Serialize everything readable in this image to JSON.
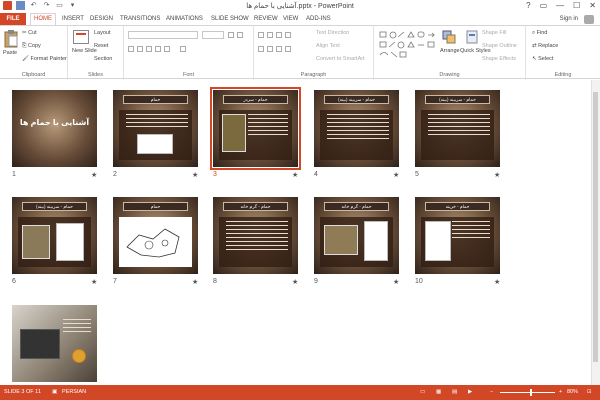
{
  "window": {
    "title": "آشنایی با حمام ها.pptx - PowerPoint",
    "controls": [
      "?",
      "▭",
      "—",
      "☐",
      "✕"
    ]
  },
  "tabs": [
    {
      "label": "FILE"
    },
    {
      "label": "HOME"
    },
    {
      "label": "INSERT"
    },
    {
      "label": "DESIGN"
    },
    {
      "label": "TRANSITIONS"
    },
    {
      "label": "ANIMATIONS"
    },
    {
      "label": "SLIDE SHOW"
    },
    {
      "label": "REVIEW"
    },
    {
      "label": "VIEW"
    },
    {
      "label": "ADD-INS"
    }
  ],
  "account": {
    "signin": "Sign in"
  },
  "ribbon": {
    "clipboard": {
      "label": "Clipboard",
      "paste": "Paste",
      "cut": "Cut",
      "copy": "Copy",
      "format_painter": "Format Painter"
    },
    "slides": {
      "label": "Slides",
      "new_slide": "New Slide",
      "layout": "Layout",
      "reset": "Reset",
      "section": "Section"
    },
    "font": {
      "label": "Font"
    },
    "paragraph": {
      "label": "Paragraph",
      "text_direction": "Text Direction",
      "align_text": "Align Text",
      "convert_smartart": "Convert to SmartArt"
    },
    "drawing": {
      "label": "Drawing",
      "arrange": "Arrange",
      "quick_styles": "Quick Styles",
      "shape_fill": "Shape Fill",
      "shape_outline": "Shape Outline",
      "shape_effects": "Shape Effects"
    },
    "editing": {
      "label": "Editing",
      "find": "Find",
      "replace": "Replace",
      "select": "Select"
    }
  },
  "slides": [
    {
      "num": "1",
      "star": "★",
      "title": "",
      "big_title": "آشنایی با حمام ها",
      "kind": "cover"
    },
    {
      "num": "2",
      "star": "★",
      "title": "حمام",
      "kind": "text-sketch"
    },
    {
      "num": "3",
      "star": "★",
      "title": "حمام - سردر",
      "kind": "text-pic",
      "selected": true
    },
    {
      "num": "4",
      "star": "★",
      "title": "حمام - سربینه (بینه)",
      "kind": "text"
    },
    {
      "num": "5",
      "star": "★",
      "title": "حمام - سربینه (بینه)",
      "kind": "text"
    },
    {
      "num": "6",
      "star": "★",
      "title": "حمام - سربینه (بینه)",
      "kind": "pics"
    },
    {
      "num": "7",
      "star": "★",
      "title": "حمام",
      "kind": "plan"
    },
    {
      "num": "8",
      "star": "★",
      "title": "حمام - گرم خانه",
      "kind": "text"
    },
    {
      "num": "9",
      "star": "★",
      "title": "حمام - گرم خانه",
      "kind": "pics"
    },
    {
      "num": "10",
      "star": "★",
      "title": "حمام - خزینه",
      "kind": "text-sketch"
    },
    {
      "num": "",
      "star": "",
      "title": "",
      "kind": "photo"
    }
  ],
  "statusbar": {
    "slide_info": "SLIDE 3 OF 11",
    "language": "PERSIAN",
    "zoom": "80%"
  },
  "colors": {
    "accent": "#d24726"
  }
}
